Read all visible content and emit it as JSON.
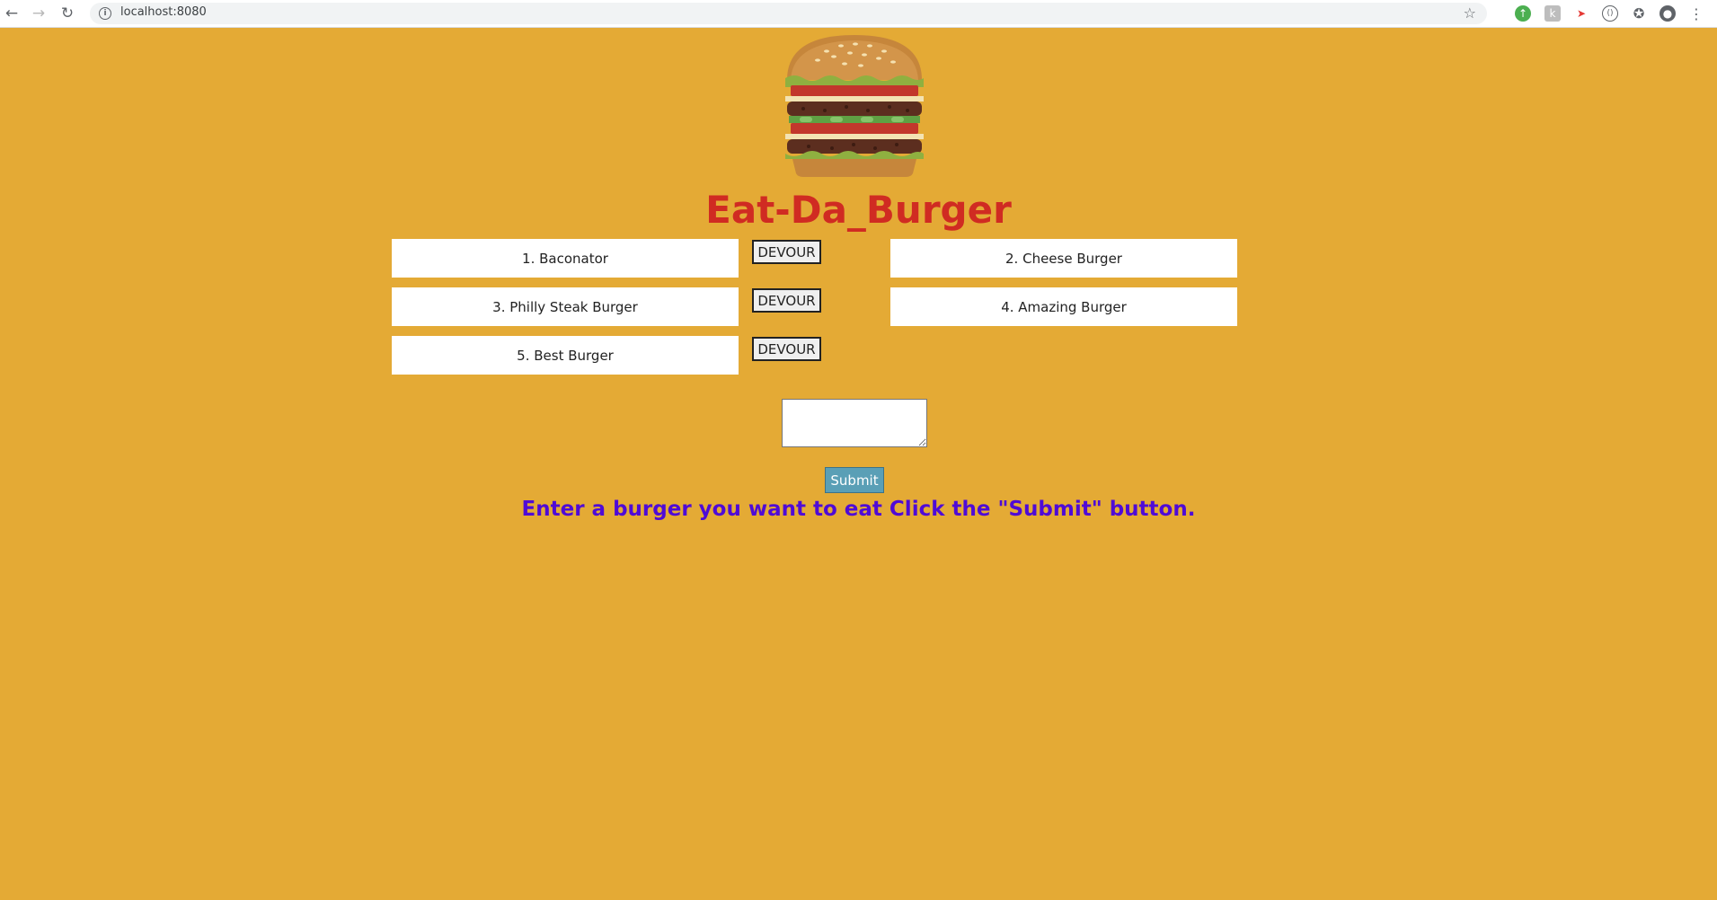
{
  "browser": {
    "url": "localhost:8080"
  },
  "page": {
    "title": "Eat-Da_Burger",
    "logo_icon": "burger-icon",
    "background_color": "#e4aa35",
    "title_color": "#d02b22",
    "instruction_color": "#4f0bd6"
  },
  "burgers_to_eat": [
    {
      "label": "1. Baconator",
      "button": "DEVOUR"
    },
    {
      "label": "3. Philly Steak Burger",
      "button": "DEVOUR"
    },
    {
      "label": "5. Best Burger",
      "button": "DEVOUR"
    }
  ],
  "devoured_burgers": [
    {
      "label": "2. Cheese Burger"
    },
    {
      "label": "4. Amazing Burger"
    }
  ],
  "form": {
    "input_value": "",
    "submit_label": "Submit",
    "instructions": "Enter a burger you want to eat Click the \"Submit\" button."
  }
}
